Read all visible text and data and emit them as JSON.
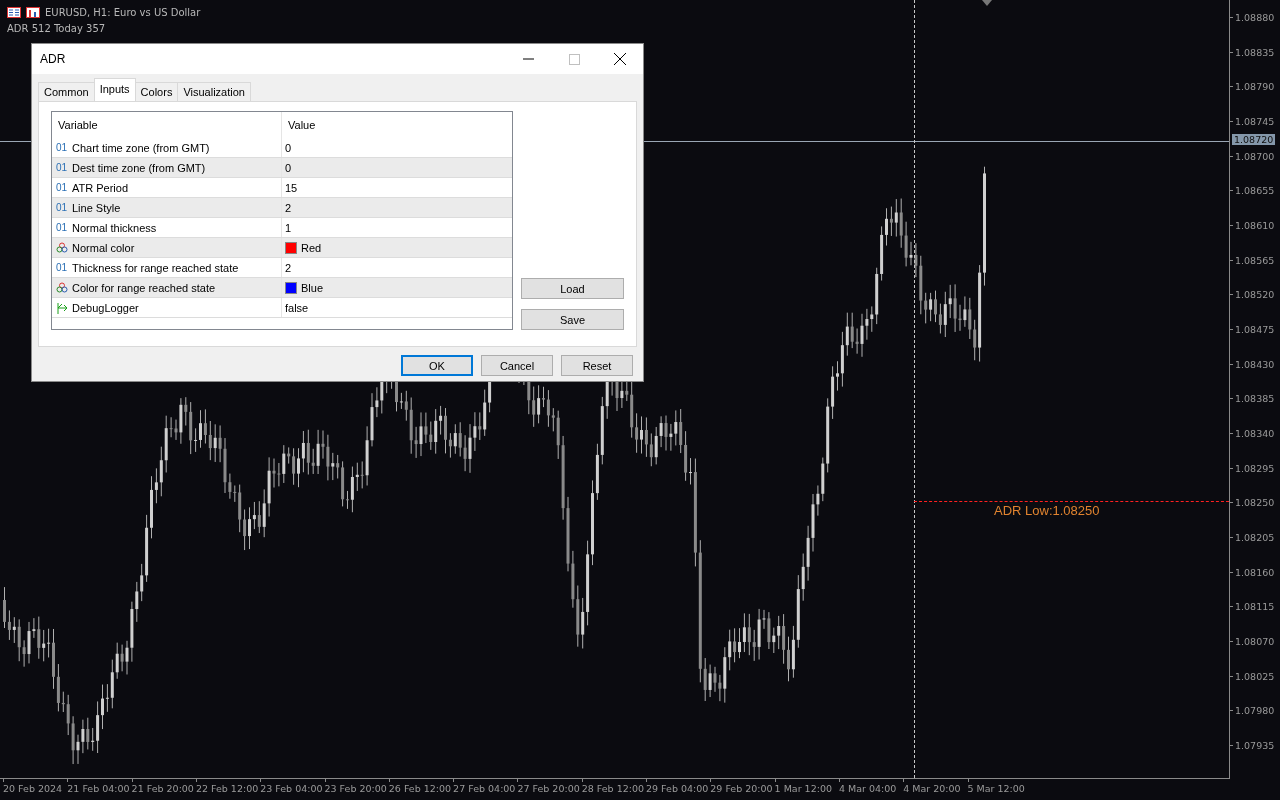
{
  "chart": {
    "symbol_title": "EURUSD, H1:  Euro vs US Dollar",
    "indicator_label": "ADR 512  Today 357",
    "current_price": "1.08720",
    "adr_line_label": "ADR Low:1.08250",
    "price_axis": [
      "1.08880",
      "1.08835",
      "1.08790",
      "1.08745",
      "1.08700",
      "1.08655",
      "1.08610",
      "1.08565",
      "1.08520",
      "1.08475",
      "1.08430",
      "1.08385",
      "1.08340",
      "1.08295",
      "1.08250",
      "1.08205",
      "1.08160",
      "1.08115",
      "1.08070",
      "1.08025",
      "1.07980",
      "1.07935"
    ],
    "time_axis": [
      "20 Feb 2024",
      "21 Feb 04:00",
      "21 Feb 20:00",
      "22 Feb 12:00",
      "23 Feb 04:00",
      "23 Feb 20:00",
      "26 Feb 12:00",
      "27 Feb 04:00",
      "27 Feb 20:00",
      "28 Feb 12:00",
      "29 Feb 04:00",
      "29 Feb 20:00",
      "1 Mar 12:00",
      "4 Mar 04:00",
      "4 Mar 20:00",
      "5 Mar 12:00"
    ]
  },
  "dialog": {
    "title": "ADR",
    "tabs": [
      {
        "label": "Common",
        "selected": false
      },
      {
        "label": "Inputs",
        "selected": true
      },
      {
        "label": "Colors",
        "selected": false
      },
      {
        "label": "Visualization",
        "selected": false
      }
    ],
    "columns": [
      "Variable",
      "Value"
    ],
    "rows": [
      {
        "kind": "int",
        "icon": "01",
        "name": "Chart time zone (from GMT)",
        "value": "0"
      },
      {
        "kind": "int",
        "icon": "01",
        "name": "Dest time zone (from GMT)",
        "value": "0"
      },
      {
        "kind": "int",
        "icon": "01",
        "name": "ATR Period",
        "value": "15"
      },
      {
        "kind": "int",
        "icon": "01",
        "name": "Line Style",
        "value": "2"
      },
      {
        "kind": "int",
        "icon": "01",
        "name": "Normal thickness",
        "value": "1"
      },
      {
        "kind": "color",
        "name": "Normal color",
        "value": "Red",
        "color": "#ff0000"
      },
      {
        "kind": "int",
        "icon": "01",
        "name": "Thickness for range reached state",
        "value": "2"
      },
      {
        "kind": "color",
        "name": "Color for range reached state",
        "value": "Blue",
        "color": "#0000ff"
      },
      {
        "kind": "bool",
        "name": "DebugLogger",
        "value": "false"
      }
    ],
    "side_buttons": [
      "Load",
      "Save"
    ],
    "buttons": [
      {
        "label": "OK",
        "default": true
      },
      {
        "label": "Cancel",
        "default": false
      },
      {
        "label": "Reset",
        "default": false
      }
    ]
  }
}
